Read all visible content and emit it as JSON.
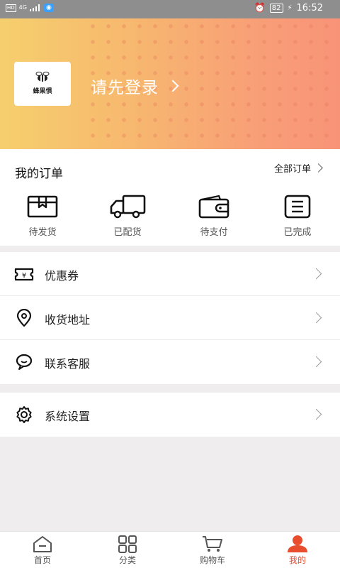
{
  "status_bar": {
    "network": "4G",
    "battery": "82",
    "time": "16:52"
  },
  "header": {
    "logo_text": "蜂果惧",
    "login_label": "请先登录"
  },
  "orders": {
    "title": "我的订单",
    "all_label": "全部订单",
    "items": [
      {
        "label": "待发货",
        "icon": "package-icon"
      },
      {
        "label": "已配货",
        "icon": "truck-icon"
      },
      {
        "label": "待支付",
        "icon": "wallet-icon"
      },
      {
        "label": "已完成",
        "icon": "list-doc-icon"
      }
    ]
  },
  "menu": {
    "coupons": "优惠券",
    "address": "收货地址",
    "service": "联系客服",
    "settings": "系统设置"
  },
  "tabbar": {
    "items": [
      {
        "label": "首页",
        "icon": "home-icon"
      },
      {
        "label": "分类",
        "icon": "category-grid-icon"
      },
      {
        "label": "购物车",
        "icon": "cart-icon"
      },
      {
        "label": "我的",
        "icon": "profile-icon"
      }
    ],
    "active_index": 3,
    "active_color": "#e84d2e"
  },
  "colors": {
    "banner_start": "#f6cf6d",
    "banner_end": "#f89378",
    "accent": "#e84d2e"
  }
}
